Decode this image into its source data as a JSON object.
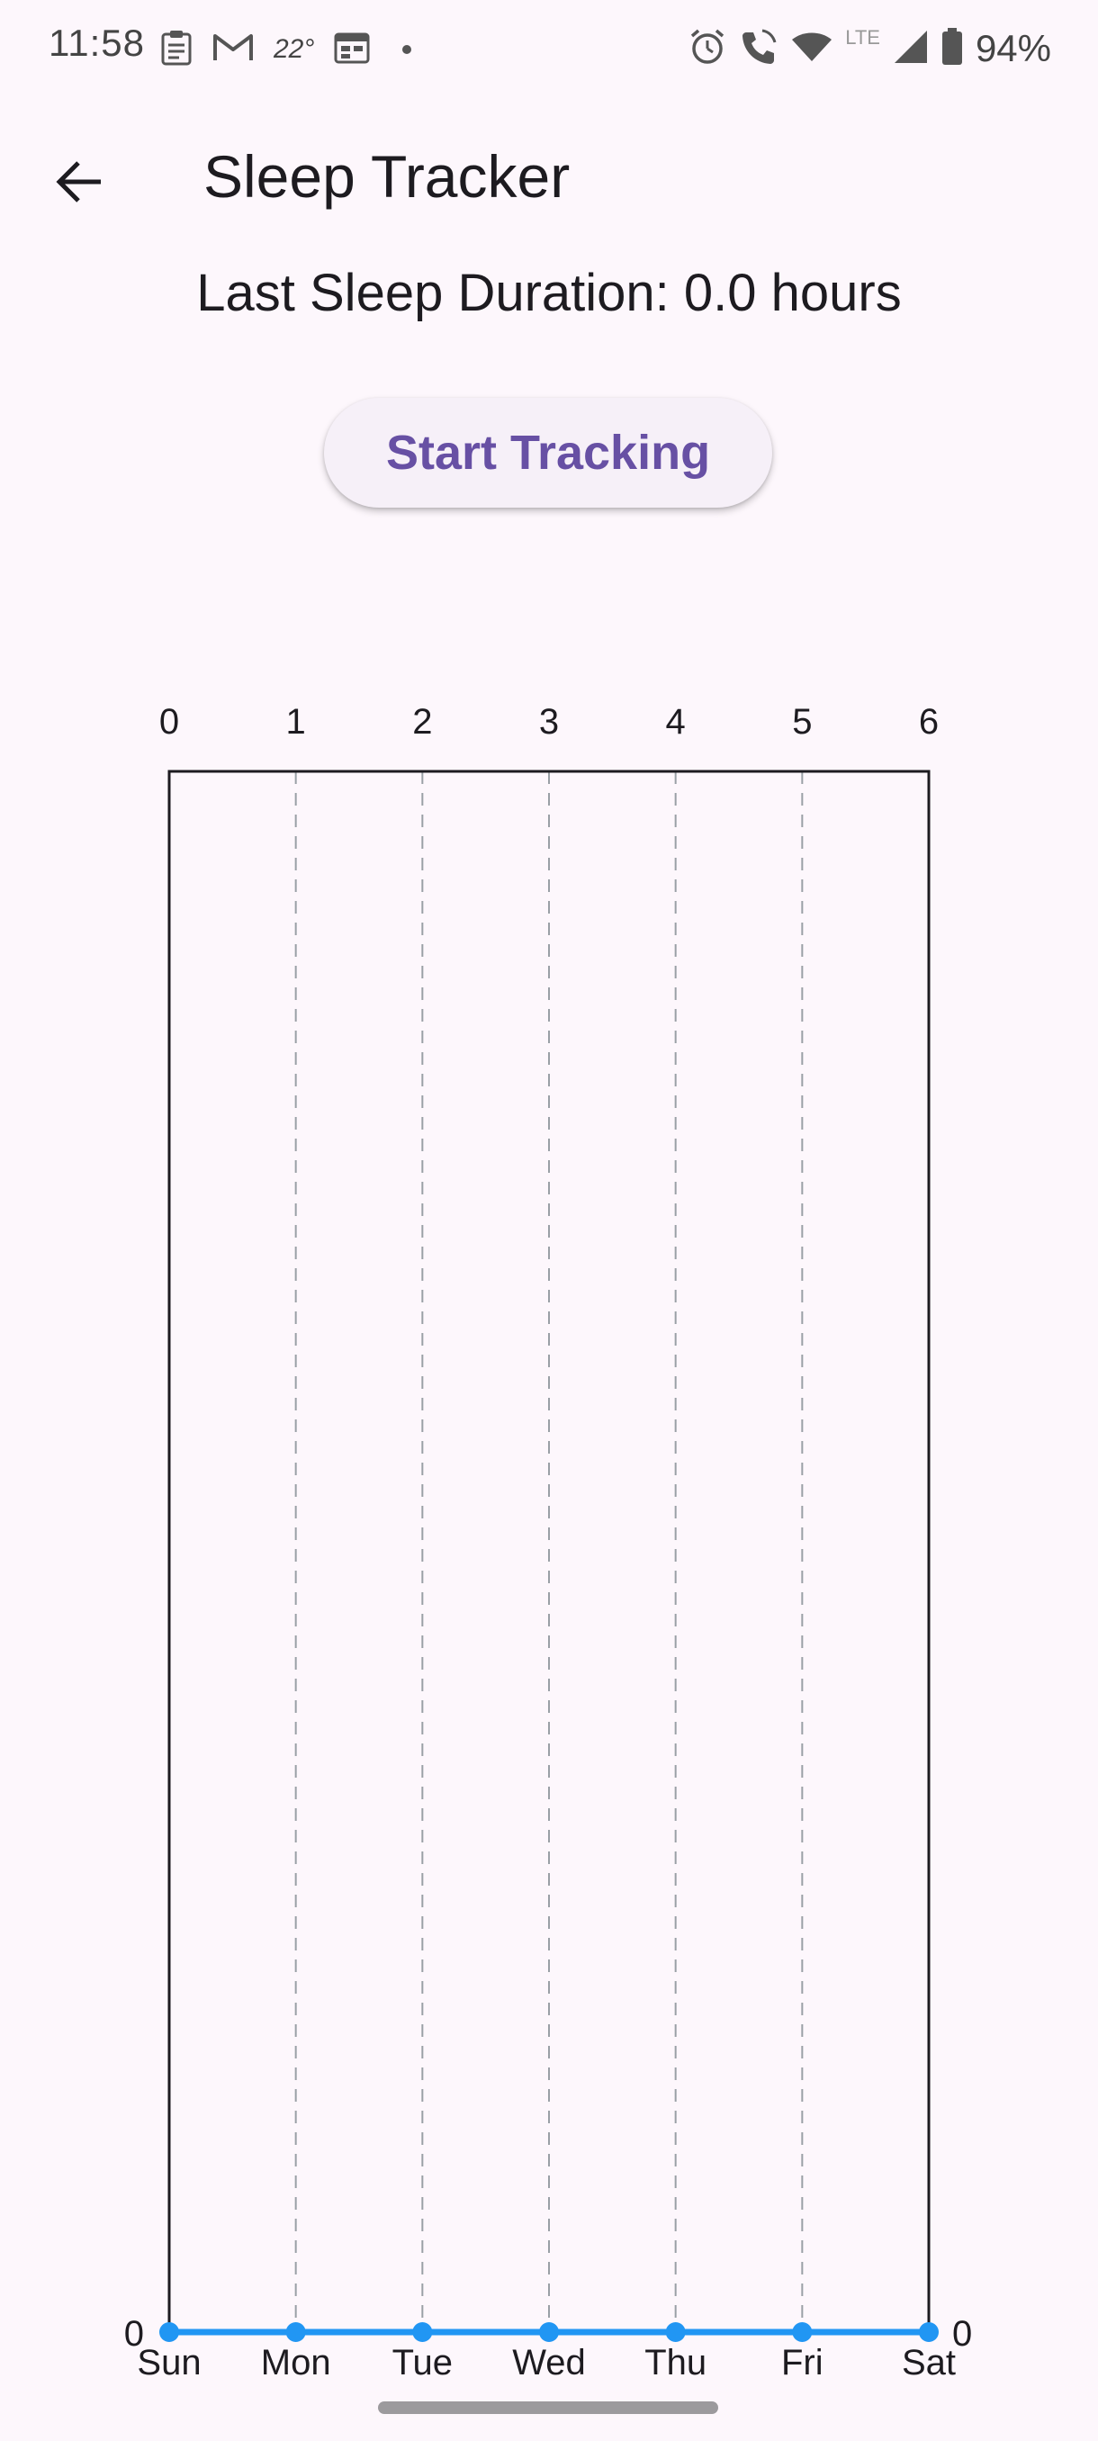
{
  "status_bar": {
    "time": "11:58",
    "temperature": "22°",
    "battery": "94%",
    "network": "LTE",
    "icons": [
      "clipboard-icon",
      "gmail-icon",
      "calendar-icon",
      "alarm-icon",
      "wifi-calling-icon",
      "wifi-icon",
      "signal-icon",
      "battery-icon"
    ]
  },
  "app_bar": {
    "title": "Sleep Tracker",
    "back_icon": "arrow-back-icon"
  },
  "main": {
    "duration_text": "Last Sleep Duration: 0.0 hours",
    "start_button_label": "Start Tracking"
  },
  "colors": {
    "background": "#fdf7fc",
    "accent": "#6750a4",
    "line": "#2196f3",
    "grid": "#9aa0a6"
  },
  "chart_data": {
    "type": "line",
    "x_ticks_top": [
      "0",
      "1",
      "2",
      "3",
      "4",
      "5",
      "6"
    ],
    "categories": [
      "Sun",
      "Mon",
      "Tue",
      "Wed",
      "Thu",
      "Fri",
      "Sat"
    ],
    "series": [
      {
        "values": [
          0,
          0,
          0,
          0,
          0,
          0,
          0
        ]
      }
    ],
    "y_left_label": "0",
    "y_right_label": "0",
    "grid": "vertical-dashed"
  }
}
